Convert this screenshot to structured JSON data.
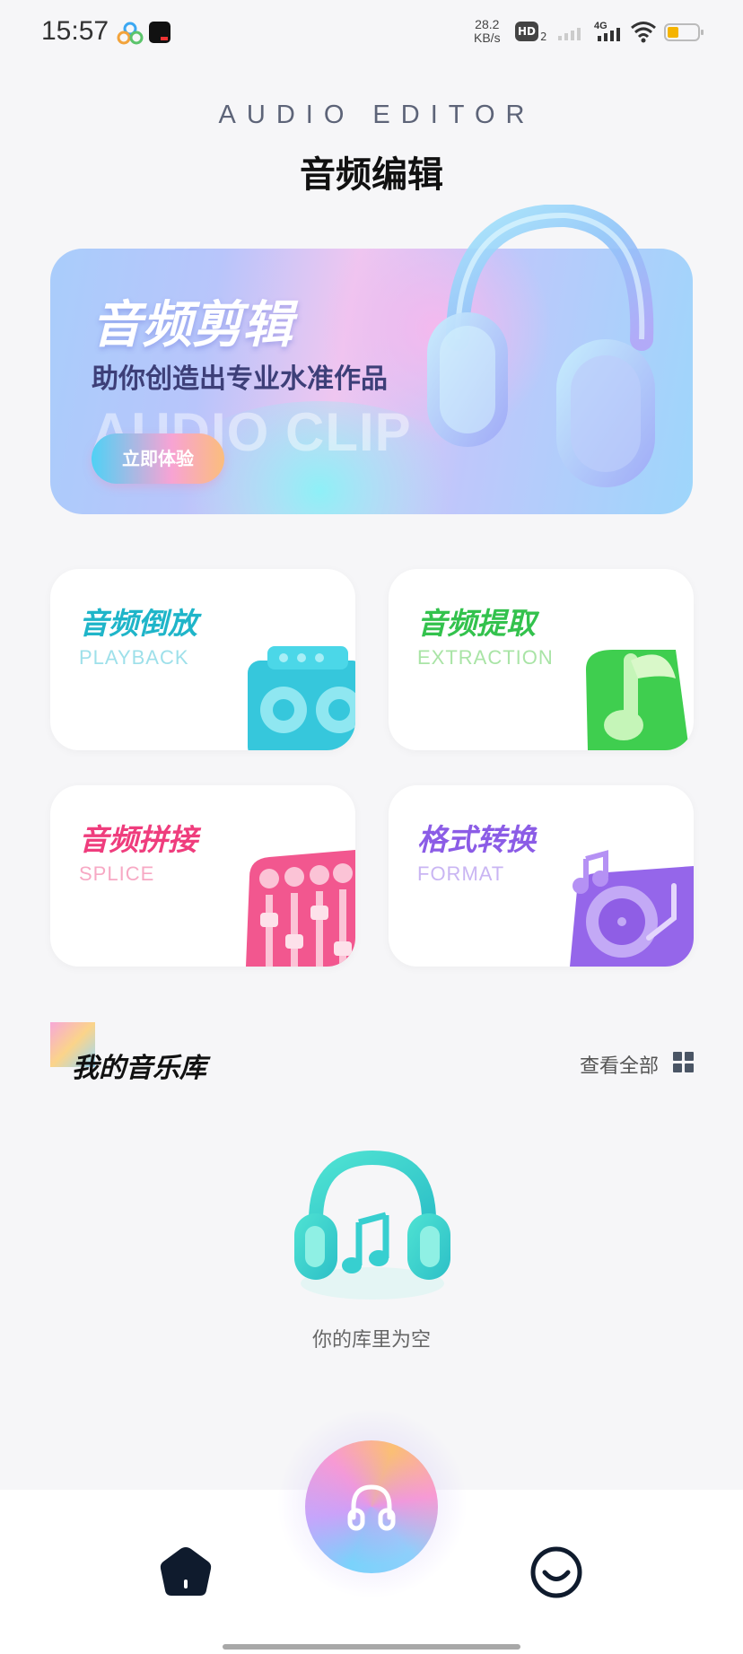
{
  "status_bar": {
    "time": "15:57",
    "net_speed_value": "28.2",
    "net_speed_unit": "KB/s",
    "hd_label": "HD",
    "hd_sub": "2",
    "network_type": "4G"
  },
  "header": {
    "title_en": "AUDIO EDITOR",
    "title_cn": "音频编辑"
  },
  "banner": {
    "title": "音频剪辑",
    "subtitle": "助你创造出专业水准作品",
    "bg_text": "AUDIO CLIP",
    "button_label": "立即体验"
  },
  "features": [
    {
      "title": "音频倒放",
      "subtitle": "PLAYBACK",
      "color": "#1fb5c9",
      "sub_color": "#9ee0ea"
    },
    {
      "title": "音频提取",
      "subtitle": "EXTRACTION",
      "color": "#33c24d",
      "sub_color": "#a9e4a6"
    },
    {
      "title": "音频拼接",
      "subtitle": "SPLICE",
      "color": "#ef3d7d",
      "sub_color": "#f7a9c4"
    },
    {
      "title": "格式转换",
      "subtitle": "FORMAT",
      "color": "#8b5ce6",
      "sub_color": "#c9b5f3"
    }
  ],
  "library": {
    "title": "我的音乐库",
    "view_all": "查看全部",
    "empty_text": "你的库里为空"
  },
  "nav": {
    "home_icon": "home-icon",
    "center_icon": "headphones-icon",
    "profile_icon": "smile-face-icon"
  }
}
